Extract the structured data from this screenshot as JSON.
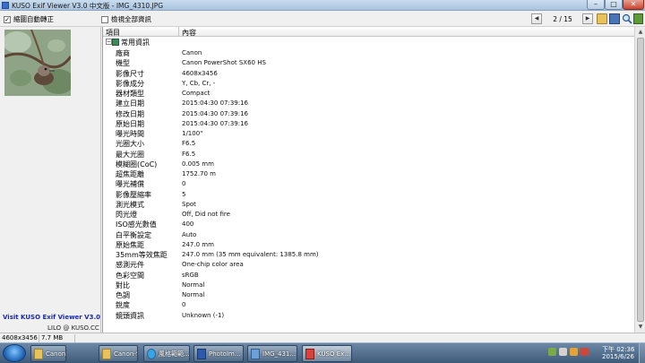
{
  "window": {
    "title": "KUSO Exif Viewer V3.0 中文版 - IMG_4310.JPG",
    "min": "–",
    "max": "□",
    "close": "✕"
  },
  "toolbar": {
    "auto_rotate_label": "縮圖自動轉正",
    "auto_rotate_checked": "✓",
    "show_all_label": "檢視全部資訊",
    "prev": "◀",
    "next": "▶",
    "page_counter": "2 / 15"
  },
  "left_panel": {
    "site_text": "Visit KUSO Exif Viewer V3.0 Site",
    "author_text": "LILO @ KUSO.CC"
  },
  "list": {
    "col_item": "項目",
    "col_value": "內容",
    "group_expander": "−",
    "group_label": "常用資訊",
    "rows": [
      {
        "k": "廠商",
        "v": "Canon"
      },
      {
        "k": "機型",
        "v": "Canon PowerShot SX60 HS"
      },
      {
        "k": "影像尺寸",
        "v": "4608x3456"
      },
      {
        "k": "影像成分",
        "v": "Y, Cb, Cr, -"
      },
      {
        "k": "器材類型",
        "v": "Compact"
      },
      {
        "k": "建立日期",
        "v": "2015:04:30 07:39:16"
      },
      {
        "k": "修改日期",
        "v": "2015:04:30 07:39:16"
      },
      {
        "k": "原始日期",
        "v": "2015:04:30 07:39:16"
      },
      {
        "k": "曝光時間",
        "v": "1/100\""
      },
      {
        "k": "光圈大小",
        "v": "F6.5"
      },
      {
        "k": "最大光圈",
        "v": "F6.5"
      },
      {
        "k": "模糊圈(CoC)",
        "v": "0.005 mm"
      },
      {
        "k": "超焦距離",
        "v": "1752.70 m"
      },
      {
        "k": "曝光補償",
        "v": "0"
      },
      {
        "k": "影像壓縮率",
        "v": "5"
      },
      {
        "k": "測光模式",
        "v": "Spot"
      },
      {
        "k": "閃光燈",
        "v": "Off, Did not fire"
      },
      {
        "k": "ISO感光數值",
        "v": "400"
      },
      {
        "k": "白平衡設定",
        "v": "Auto"
      },
      {
        "k": "原始焦距",
        "v": "247.0 mm"
      },
      {
        "k": "35mm等效焦距",
        "v": "247.0 mm (35 mm equivalent: 1385.8 mm)"
      },
      {
        "k": "感測元件",
        "v": "One-chip color area"
      },
      {
        "k": "色彩空間",
        "v": "sRGB"
      },
      {
        "k": "對比",
        "v": "Normal"
      },
      {
        "k": "色調",
        "v": "Normal"
      },
      {
        "k": "銳度",
        "v": "0"
      },
      {
        "k": "鏡頭資訊",
        "v": "Unknown (-1)"
      }
    ]
  },
  "scroll": {
    "up": "▲",
    "down": "▼"
  },
  "status": {
    "dimensions": "4608x3456",
    "file_size": "7.7 MB"
  },
  "taskbar": {
    "tasks": [
      {
        "label": "Canon-S..."
      },
      {
        "label": "Canon-S..."
      },
      {
        "label": "風格範範..."
      },
      {
        "label": "PhotoIm..."
      },
      {
        "label": "IMG_431..."
      },
      {
        "label": "KUSO Ex..."
      }
    ],
    "clock_time": "下午 02:36",
    "clock_date": "2015/6/26"
  }
}
